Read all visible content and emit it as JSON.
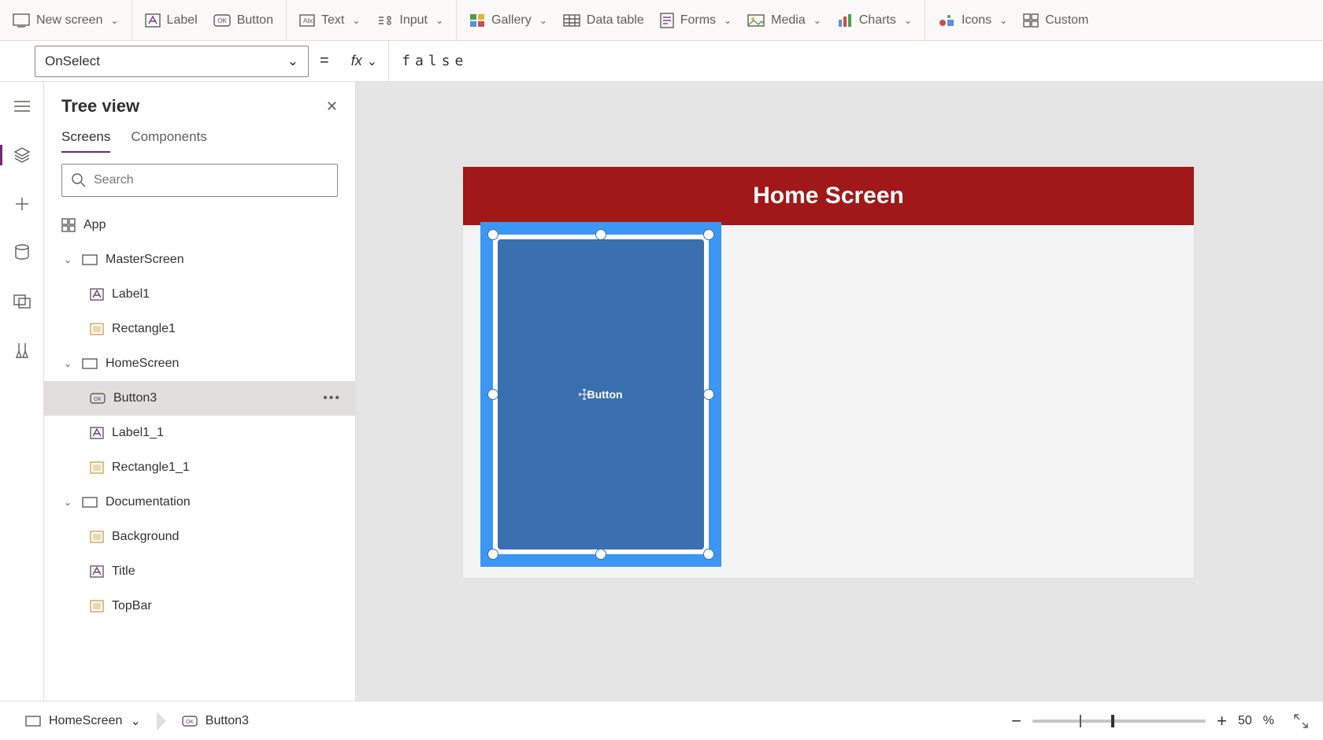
{
  "ribbon": {
    "new_screen": "New screen",
    "label": "Label",
    "button": "Button",
    "text": "Text",
    "input": "Input",
    "gallery": "Gallery",
    "data_table": "Data table",
    "forms": "Forms",
    "media": "Media",
    "charts": "Charts",
    "icons": "Icons",
    "custom": "Custom"
  },
  "formula": {
    "property": "OnSelect",
    "equals": "=",
    "fx": "fx",
    "value": "false"
  },
  "tree": {
    "title": "Tree view",
    "tabs": {
      "screens": "Screens",
      "components": "Components"
    },
    "search_placeholder": "Search",
    "app": "App",
    "items": [
      {
        "name": "MasterScreen",
        "type": "screen",
        "children": [
          "Label1",
          "Rectangle1"
        ]
      },
      {
        "name": "HomeScreen",
        "type": "screen",
        "children": [
          "Button3",
          "Label1_1",
          "Rectangle1_1"
        ]
      },
      {
        "name": "Documentation",
        "type": "screen",
        "children": [
          "Background",
          "Title",
          "TopBar"
        ]
      }
    ],
    "label1": "Label1",
    "rectangle1": "Rectangle1",
    "homescreen": "HomeScreen",
    "button3": "Button3",
    "label1_1": "Label1_1",
    "rectangle1_1": "Rectangle1_1",
    "documentation": "Documentation",
    "background": "Background",
    "title_item": "Title",
    "topbar": "TopBar",
    "masterscreen": "MasterScreen",
    "selected": "Button3"
  },
  "canvas": {
    "screen_title": "Home Screen",
    "button_text": "Button"
  },
  "status": {
    "screen": "HomeScreen",
    "control": "Button3",
    "zoom": "50",
    "zoom_unit": "%"
  }
}
